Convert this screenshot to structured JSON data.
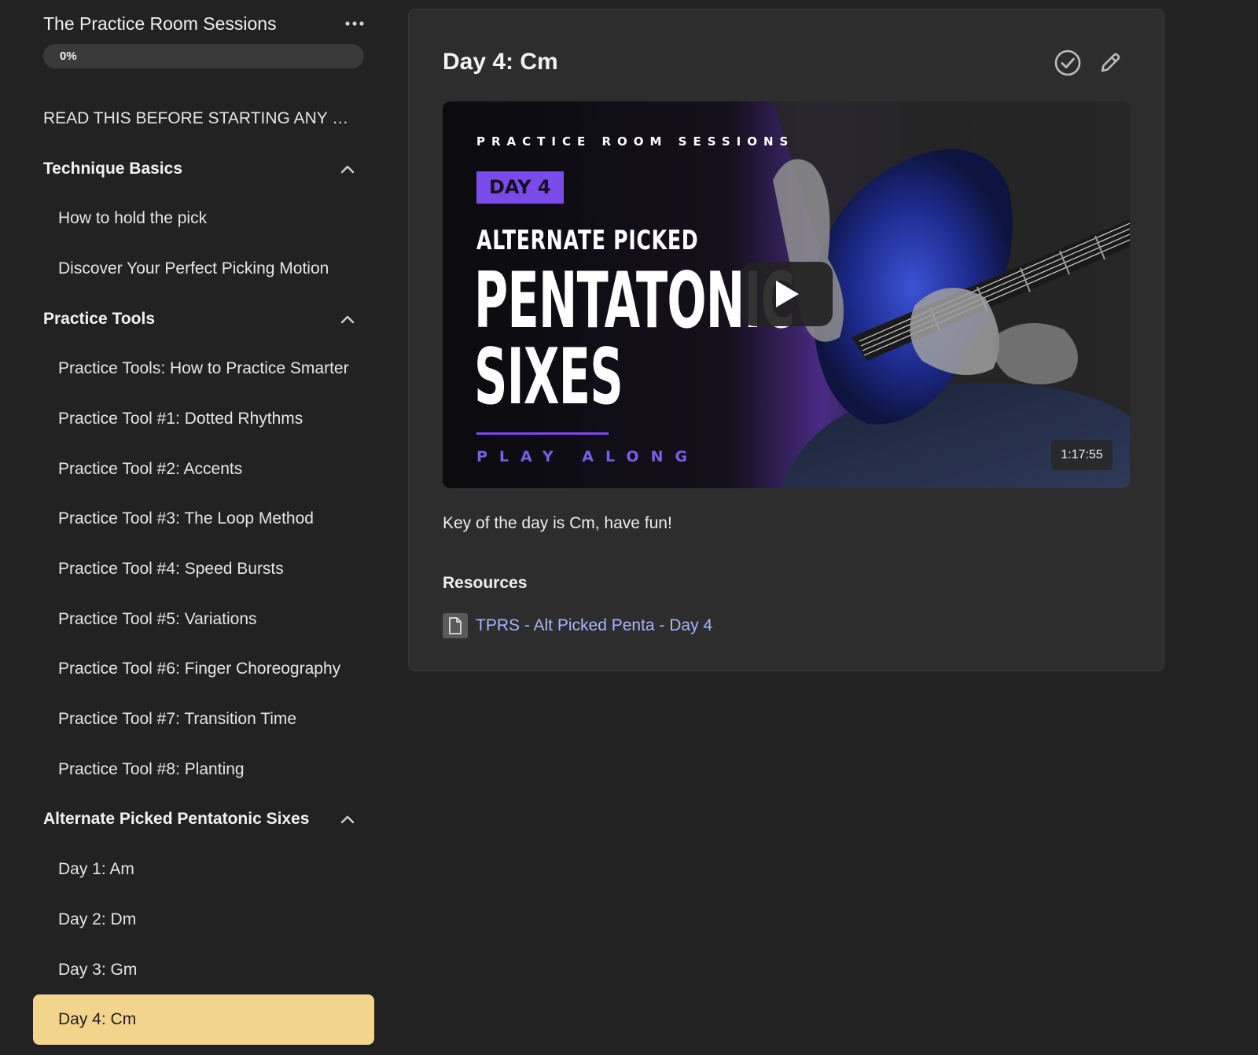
{
  "sidebar": {
    "course_title": "The Practice Room Sessions",
    "more_icon": "more-horizontal-icon",
    "progress": {
      "label": "0%",
      "value": 0
    },
    "items": [
      {
        "type": "lesson-top",
        "label": "READ THIS BEFORE STARTING ANY WOR..."
      },
      {
        "type": "section",
        "label": "Technique Basics",
        "icon": "chevron-up-icon"
      },
      {
        "type": "lesson",
        "label": "How to hold the pick"
      },
      {
        "type": "lesson",
        "label": "Discover Your Perfect Picking Motion"
      },
      {
        "type": "section",
        "label": "Practice Tools",
        "icon": "chevron-up-icon"
      },
      {
        "type": "lesson",
        "label": "Practice Tools: How to Practice Smarter"
      },
      {
        "type": "lesson",
        "label": "Practice Tool #1: Dotted Rhythms"
      },
      {
        "type": "lesson",
        "label": "Practice Tool #2: Accents"
      },
      {
        "type": "lesson",
        "label": "Practice Tool #3: The Loop Method"
      },
      {
        "type": "lesson",
        "label": "Practice Tool #4: Speed Bursts"
      },
      {
        "type": "lesson",
        "label": "Practice Tool #5: Variations"
      },
      {
        "type": "lesson",
        "label": "Practice Tool #6: Finger Choreography"
      },
      {
        "type": "lesson",
        "label": "Practice Tool #7: Transition Time"
      },
      {
        "type": "lesson",
        "label": "Practice Tool #8: Planting"
      },
      {
        "type": "section",
        "label": "Alternate Picked Pentatonic Sixes",
        "icon": "chevron-up-icon"
      },
      {
        "type": "lesson",
        "label": "Day 1: Am"
      },
      {
        "type": "lesson",
        "label": "Day 2: Dm"
      },
      {
        "type": "lesson",
        "label": "Day 3: Gm"
      },
      {
        "type": "lesson",
        "label": "Day 4: Cm",
        "active": true
      }
    ]
  },
  "lesson": {
    "title": "Day 4: Cm",
    "complete_icon": "check-circle-icon",
    "edit_icon": "pencil-icon",
    "video": {
      "thumbnail_text": {
        "brand": "PRACTICE ROOM SESSIONS",
        "day": "DAY 4",
        "subtitle": "ALTERNATE PICKED",
        "title_line1": "PENTATONIC",
        "title_line2": "SIXES",
        "tagline": "PLAY ALONG"
      },
      "play_icon": "play-icon",
      "duration": "1:17:55"
    },
    "description": "Key of the day is Cm, have fun!",
    "resources": {
      "heading": "Resources",
      "items": [
        {
          "icon": "file-icon",
          "label": "TPRS - Alt Picked Penta - Day 4"
        }
      ]
    }
  },
  "colors": {
    "background": "#222222",
    "card": "#2d2d2d",
    "active_item": "#f3d48d",
    "accent_purple": "#7b4bea",
    "link": "#a8b4ff"
  }
}
